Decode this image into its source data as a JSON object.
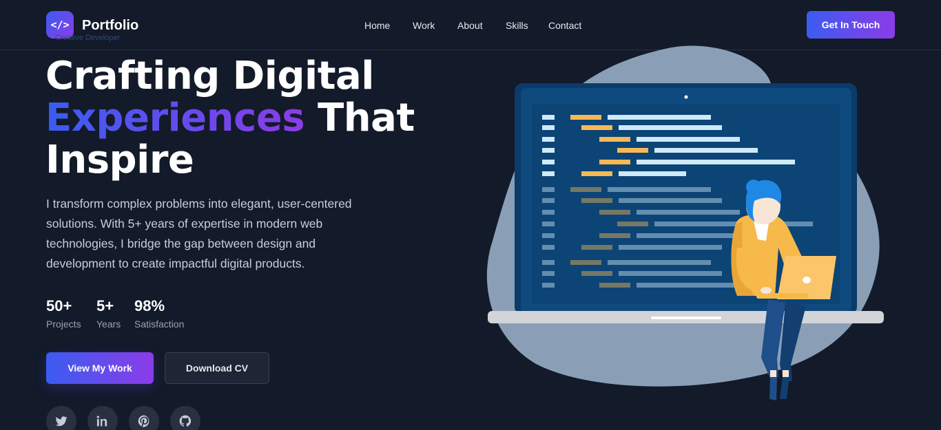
{
  "brand": {
    "logo_glyph": "</>",
    "name": "Portfolio",
    "tagline": "Creative Developer"
  },
  "nav": {
    "items": [
      "Home",
      "Work",
      "About",
      "Skills",
      "Contact"
    ]
  },
  "header": {
    "cta_label": "Get In Touch"
  },
  "hero": {
    "title_line1": "Crafting Digital",
    "title_highlight": "Experiences",
    "title_line2_rest": " That",
    "title_line3": "Inspire",
    "description": "I transform complex problems into elegant, user-centered solutions. With 5+ years of expertise in modern web technologies, I bridge the gap between design and development to create impactful digital products."
  },
  "stats": [
    {
      "value": "50+",
      "label": "Projects"
    },
    {
      "value": "5+",
      "label": "Years"
    },
    {
      "value": "98%",
      "label": "Satisfaction"
    }
  ],
  "actions": {
    "primary_label": "View My Work",
    "secondary_label": "Download CV"
  },
  "social": [
    "twitter-icon",
    "linkedin-icon",
    "pinterest-icon",
    "github-icon"
  ],
  "colors": {
    "background": "#131a29",
    "accent_start": "#3b5cf0",
    "accent_end": "#8b3ce8",
    "illustration_blob": "#8a9fb5",
    "screen": "#0c4476",
    "code_orange": "#f7b955",
    "code_light": "#cfe9f7"
  }
}
